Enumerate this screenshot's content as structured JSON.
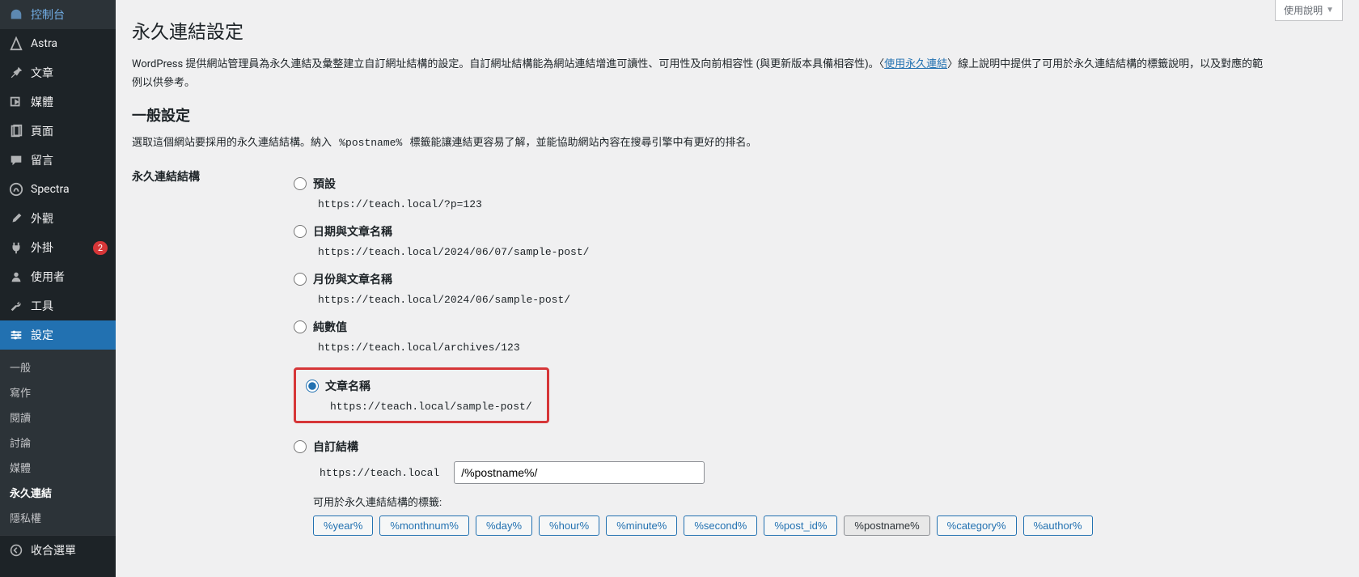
{
  "sidebar": {
    "items": [
      {
        "label": "控制台",
        "icon": "dashboard"
      },
      {
        "label": "Astra",
        "icon": "astra"
      },
      {
        "label": "文章",
        "icon": "pin"
      },
      {
        "label": "媒體",
        "icon": "media"
      },
      {
        "label": "頁面",
        "icon": "page"
      },
      {
        "label": "留言",
        "icon": "comment"
      },
      {
        "label": "Spectra",
        "icon": "spectra"
      },
      {
        "label": "外觀",
        "icon": "brush"
      },
      {
        "label": "外掛",
        "icon": "plug",
        "badge": "2"
      },
      {
        "label": "使用者",
        "icon": "user"
      },
      {
        "label": "工具",
        "icon": "wrench"
      },
      {
        "label": "設定",
        "icon": "settings",
        "current": true
      }
    ],
    "submenu": [
      {
        "label": "一般"
      },
      {
        "label": "寫作"
      },
      {
        "label": "閱讀"
      },
      {
        "label": "討論"
      },
      {
        "label": "媒體"
      },
      {
        "label": "永久連結",
        "current": true
      },
      {
        "label": "隱私權"
      }
    ],
    "collapse": "收合選單"
  },
  "help_tab": "使用說明",
  "page_title": "永久連結設定",
  "intro": {
    "pre": "WordPress 提供網站管理員為永久連結及彙整建立自訂網址結構的設定。自訂網址結構能為網站連結增進可讀性、可用性及向前相容性 (與更新版本具備相容性)。〈",
    "link": "使用永久連結",
    "post": "〉線上說明中提供了可用於永久連結結構的標籤說明，以及對應的範例以供參考。"
  },
  "section_title": "一般設定",
  "desc": {
    "pre": "選取這個網站要採用的永久連結結構。納入 ",
    "code": "%postname%",
    "post": " 標籤能讓連結更容易了解，並能協助網站內容在搜尋引擎中有更好的排名。"
  },
  "structure_label": "永久連結結構",
  "options": [
    {
      "label": "預設",
      "url": "https://teach.local/?p=123"
    },
    {
      "label": "日期與文章名稱",
      "url": "https://teach.local/2024/06/07/sample-post/"
    },
    {
      "label": "月份與文章名稱",
      "url": "https://teach.local/2024/06/sample-post/"
    },
    {
      "label": "純數值",
      "url": "https://teach.local/archives/123"
    },
    {
      "label": "文章名稱",
      "url": "https://teach.local/sample-post/",
      "selected": true,
      "highlight": true
    },
    {
      "label": "自訂結構"
    }
  ],
  "custom": {
    "base": "https://teach.local",
    "value": "/%postname%/"
  },
  "tags_label": "可用於永久連結結構的標籤:",
  "tags": [
    {
      "label": "%year%"
    },
    {
      "label": "%monthnum%"
    },
    {
      "label": "%day%"
    },
    {
      "label": "%hour%"
    },
    {
      "label": "%minute%"
    },
    {
      "label": "%second%"
    },
    {
      "label": "%post_id%"
    },
    {
      "label": "%postname%",
      "active": true
    },
    {
      "label": "%category%"
    },
    {
      "label": "%author%"
    }
  ]
}
